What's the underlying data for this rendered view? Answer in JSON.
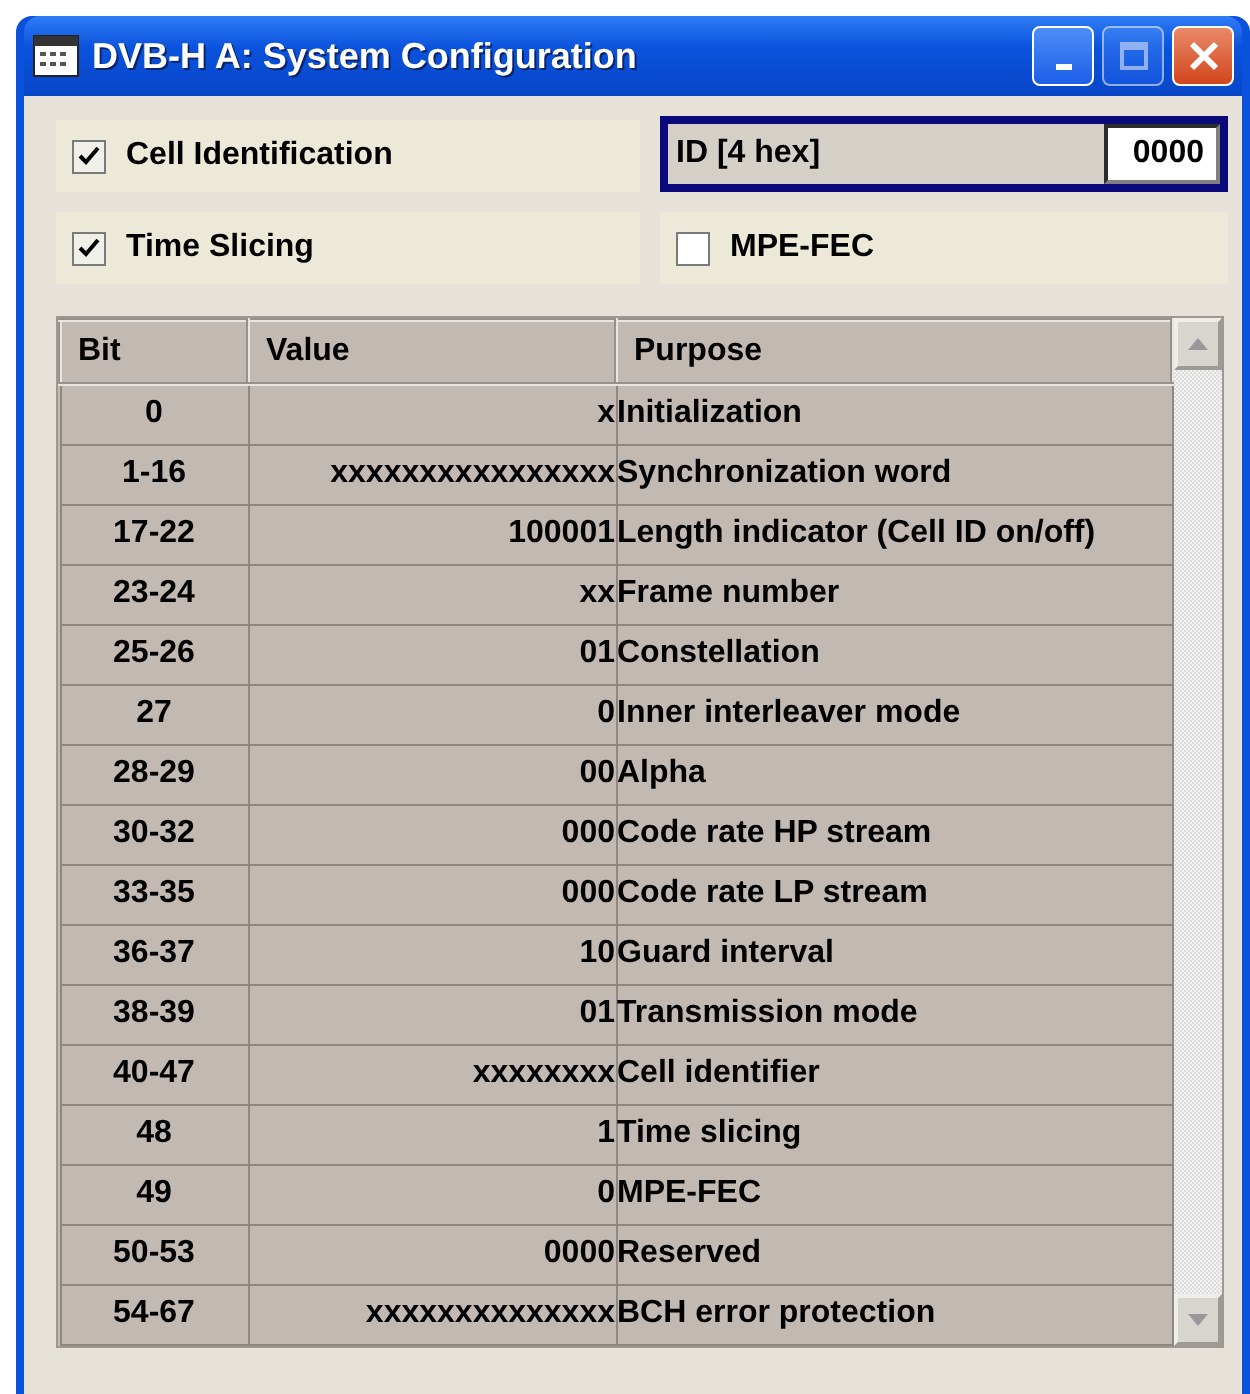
{
  "window": {
    "title": "DVB-H A: System Configuration"
  },
  "title_buttons": [
    {
      "kind": "minimize",
      "disabled": false
    },
    {
      "kind": "maximize",
      "disabled": true
    },
    {
      "kind": "close",
      "disabled": false
    }
  ],
  "controls": [
    {
      "kind": "checkbox",
      "label": "Cell Identification",
      "checked": true
    },
    {
      "kind": "field",
      "label": "ID [4 hex]",
      "value": "0000",
      "focused": true
    },
    {
      "kind": "checkbox",
      "label": "Time Slicing",
      "checked": true
    },
    {
      "kind": "checkbox",
      "label": "MPE-FEC",
      "checked": false
    }
  ],
  "table": {
    "columns": [
      "Bit",
      "Value",
      "Purpose"
    ],
    "rows": [
      [
        "0",
        "x",
        "Initialization"
      ],
      [
        "1-16",
        "xxxxxxxxxxxxxxxx",
        "Synchronization word"
      ],
      [
        "17-22",
        "100001",
        "Length indicator (Cell ID on/off)"
      ],
      [
        "23-24",
        "xx",
        "Frame number"
      ],
      [
        "25-26",
        "01",
        "Constellation"
      ],
      [
        "27",
        "0",
        "Inner interleaver mode"
      ],
      [
        "28-29",
        "00",
        "Alpha"
      ],
      [
        "30-32",
        "000",
        "Code rate HP stream"
      ],
      [
        "33-35",
        "000",
        "Code rate LP stream"
      ],
      [
        "36-37",
        "10",
        "Guard interval"
      ],
      [
        "38-39",
        "01",
        "Transmission mode"
      ],
      [
        "40-47",
        "xxxxxxxx",
        "Cell identifier"
      ],
      [
        "48",
        "1",
        "Time slicing"
      ],
      [
        "49",
        "0",
        "MPE-FEC"
      ],
      [
        "50-53",
        "0000",
        "Reserved"
      ],
      [
        "54-67",
        "xxxxxxxxxxxxxx",
        "BCH error protection"
      ]
    ]
  }
}
